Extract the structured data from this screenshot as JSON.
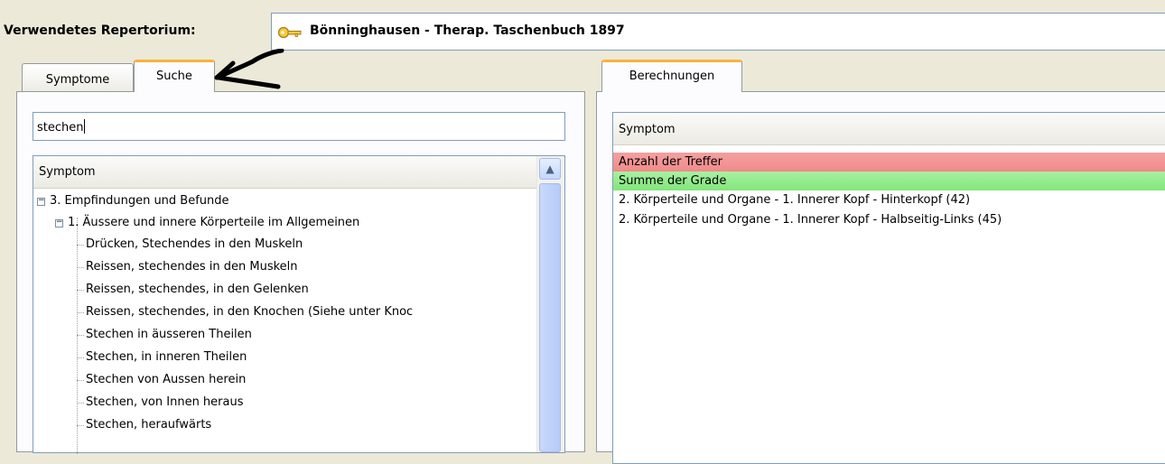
{
  "repository": {
    "label": "Verwendetes Repertorium:",
    "name": "Bönninghausen - Therap. Taschenbuch 1897",
    "icon": "key-icon"
  },
  "left_tabs": [
    {
      "label": "Symptome",
      "active": false
    },
    {
      "label": "Suche",
      "active": true
    }
  ],
  "search": {
    "value": "stechen"
  },
  "left_list": {
    "header": "Symptom",
    "tree": [
      {
        "label": "3. Empfindungen und Befunde",
        "level": 0,
        "expanded": true
      },
      {
        "label": "1. Äussere und innere Körperteile im Allgemeinen",
        "level": 1,
        "expanded": true
      },
      {
        "label": "Drücken, Stechendes in den Muskeln",
        "level": 2
      },
      {
        "label": "Reissen, stechendes in den Muskeln",
        "level": 2
      },
      {
        "label": "Reissen, stechendes, in den Gelenken",
        "level": 2
      },
      {
        "label": "Reissen, stechendes, in den Knochen (Siehe unter Knoc",
        "level": 2
      },
      {
        "label": "Stechen in äusseren Theilen",
        "level": 2
      },
      {
        "label": "Stechen, in inneren Theilen",
        "level": 2
      },
      {
        "label": "Stechen von Aussen herein",
        "level": 2
      },
      {
        "label": "Stechen, von Innen heraus",
        "level": 2
      },
      {
        "label": "Stechen, heraufwärts",
        "level": 2
      }
    ]
  },
  "right_tabs": [
    {
      "label": "Berechnungen",
      "active": true
    }
  ],
  "right_list": {
    "header": "Symptom",
    "rows": [
      {
        "label": "Anzahl der Treffer",
        "color": "#f08a8a"
      },
      {
        "label": "Summe der Grade",
        "color": "#82e67b"
      },
      {
        "label": "2. Körperteile und Organe - 1. Innerer Kopf - Hinterkopf (42)"
      },
      {
        "label": "2. Körperteile und Organe - 1. Innerer Kopf - Halbseitig-Links (45)"
      }
    ]
  },
  "colors": {
    "tab_accent": "#f9b43a",
    "window_bg": "#ece9d8",
    "hits_row": "#f08a8a",
    "grades_row": "#82e67b"
  }
}
